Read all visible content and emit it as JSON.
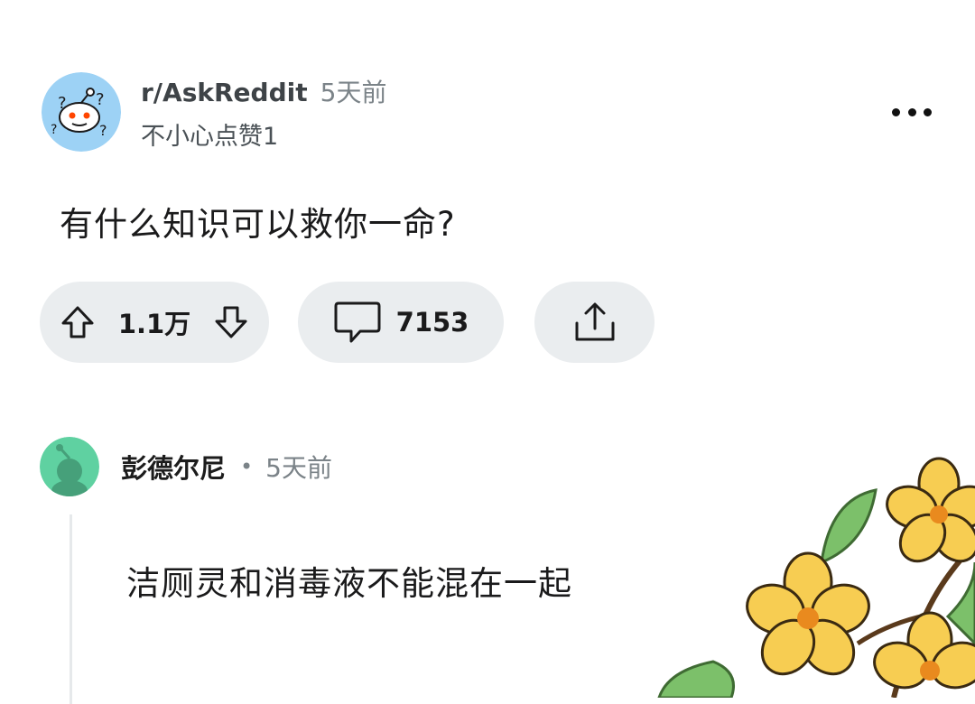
{
  "post": {
    "subreddit": "r/AskReddit",
    "time": "5天前",
    "flair": "不小心点赞1",
    "title": "有什么知识可以救你一命?",
    "more_icon": "more-horizontal-icon"
  },
  "actions": {
    "upvote_icon": "arrow-up-icon",
    "downvote_icon": "arrow-down-icon",
    "vote_count": "1.1万",
    "comment_icon": "comment-bubble-icon",
    "comment_count": "7153",
    "share_icon": "share-icon"
  },
  "comment": {
    "username": "彭德尔尼",
    "separator": "•",
    "time": "5天前",
    "body": "洁厕灵和消毒液不能混在一起"
  },
  "colors": {
    "pill_background": "#eaedef",
    "subreddit_avatar": "#9dd2f5",
    "user_avatar": "#5fd1a1",
    "muted_text": "#7b8388",
    "flower_petal": "#f7cd52",
    "flower_center": "#e98a1e",
    "leaf": "#7cc06a"
  }
}
